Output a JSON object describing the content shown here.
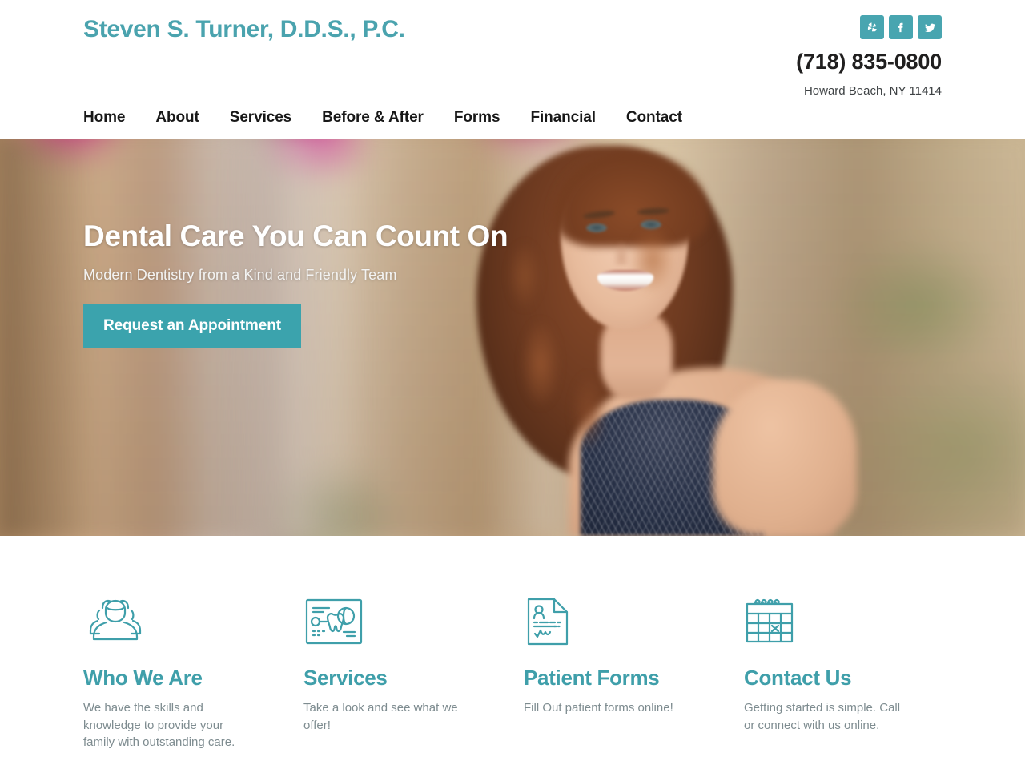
{
  "header": {
    "logo": "Steven S. Turner, D.D.S., P.C.",
    "phone": "(718) 835-0800",
    "address": "Howard Beach, NY 11414",
    "social": [
      {
        "name": "yelp",
        "label": "Yelp"
      },
      {
        "name": "facebook",
        "label": "Facebook"
      },
      {
        "name": "twitter",
        "label": "Twitter"
      }
    ],
    "nav": [
      {
        "label": "Home"
      },
      {
        "label": "About"
      },
      {
        "label": "Services"
      },
      {
        "label": "Before & After"
      },
      {
        "label": "Forms"
      },
      {
        "label": "Financial"
      },
      {
        "label": "Contact"
      }
    ]
  },
  "hero": {
    "title": "Dental Care You Can Count On",
    "subtitle": "Modern Dentistry from a Kind and Friendly Team",
    "cta": "Request an Appointment"
  },
  "features": [
    {
      "icon": "people-group-icon",
      "title": "Who We Are",
      "text": "We have the skills and knowledge to provide your family with outstanding care."
    },
    {
      "icon": "dental-chart-icon",
      "title": "Services",
      "text": "Take a look and see what we offer!"
    },
    {
      "icon": "document-form-icon",
      "title": "Patient Forms",
      "text": "Fill Out patient forms online!"
    },
    {
      "icon": "calendar-icon",
      "title": "Contact Us",
      "text": "Getting started is simple. Call or connect with us online."
    }
  ],
  "colors": {
    "accent": "#3BA3AD",
    "heading": "#3F9FAA",
    "logo": "#4AA3AE",
    "body_text": "#7E8C90",
    "nav_text": "#181818"
  }
}
